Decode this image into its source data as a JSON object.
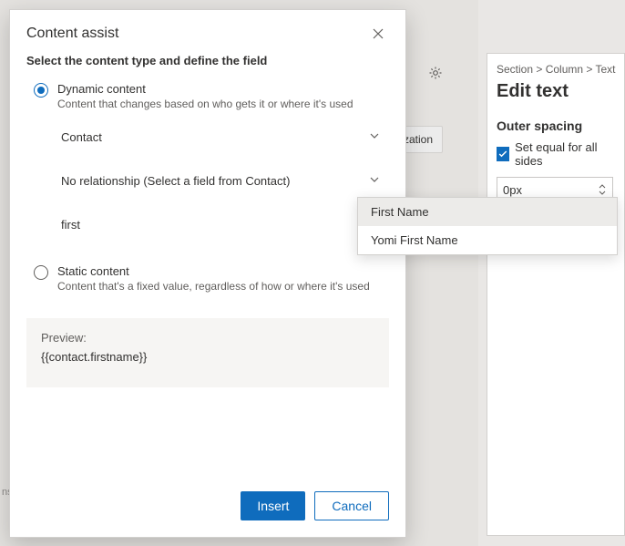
{
  "dialog": {
    "title": "Content assist",
    "subtitle": "Select the content type and define the field",
    "options": {
      "dynamic": {
        "title": "Dynamic content",
        "desc": "Content that changes based on who gets it or where it's used"
      },
      "static": {
        "title": "Static content",
        "desc": "Content that's a fixed value, regardless of how or where it's used"
      }
    },
    "fields": {
      "entity": "Contact",
      "relationship": "No relationship (Select a field from Contact)",
      "search": "first"
    },
    "preview": {
      "label": "Preview:",
      "value": "{{contact.firstname}}"
    },
    "buttons": {
      "insert": "Insert",
      "cancel": "Cancel"
    }
  },
  "suggestions": [
    "First Name",
    "Yomi First Name"
  ],
  "sidebar": {
    "breadcrumb": "Section > Column > Text",
    "title": "Edit text",
    "outer_spacing_label": "Outer spacing",
    "checkbox_label": "Set equal for all sides",
    "spinner_value": "0px"
  },
  "partial_tab": "zation",
  "bg_ns": "ns"
}
